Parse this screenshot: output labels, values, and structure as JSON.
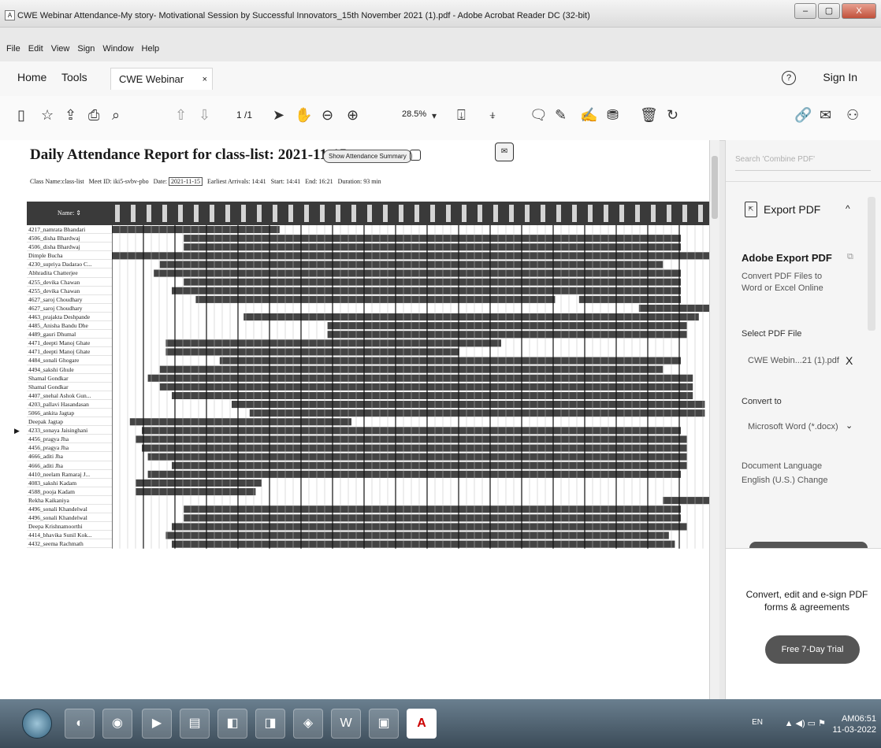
{
  "window": {
    "title": "CWE Webinar Attendance-My story- Motivational Session by Successful Innovators_15th November 2021 (1).pdf - Adobe Acrobat Reader DC (32-bit)",
    "controls": [
      "–",
      "▢",
      "X"
    ]
  },
  "menu": [
    "File",
    "Edit",
    "View",
    "Sign",
    "Window",
    "Help"
  ],
  "tabs": {
    "home": "Home",
    "tools": "Tools",
    "document": "CWE Webinar Atte...",
    "close": "×",
    "help": "?",
    "signin": "Sign In"
  },
  "toolbar": {
    "page_current": "1",
    "page_total": "/1",
    "zoom": "28.5%"
  },
  "document": {
    "title": "Daily Attendance Report for class-list: 2021-11-15",
    "summary_button": "Show Attendance Summary",
    "meta": {
      "class": "Class Name:class-list",
      "meet": "Meet ID: iki5-svbv-pbo",
      "date_label": "Date:",
      "date": "2021-11-15",
      "earliest": "Earliest Arrivals: 14:41",
      "start": "Start: 14:41",
      "end": "End: 16:21",
      "duration": "Duration: 93 min"
    },
    "name_header": "Name: ⇕",
    "attendees": [
      "4217_namrata Bhandari",
      "4506_disha Bhardwaj",
      "4506_disha Bhardwaj",
      "Dimple Bucha",
      "4230_supriya Dadarao C...",
      "Abhradita Chatterjee",
      "4255_devika Chawan",
      "4255_devika Chawan",
      "4627_saroj Choudhary",
      "4627_saroj Choudhary",
      "4463_prajakta Deshpande",
      "4485_Anisha Bandu Dhe",
      "4489_gauri Dhumal",
      "4471_deepti Manoj Ghate",
      "4471_deepti Manoj Ghate",
      "4484_sonali Ghogare",
      "4494_sakshi Ghule",
      "Shamal Gondkar",
      "Shamal Gondkar",
      "4407_snehal Ashok Gun...",
      "4203_pallavi Hasandasan",
      "5066_ankita Jagtap",
      "Deepak Jagtap",
      "4233_sonaya Jaisinghani",
      "4456_pragya Jha",
      "4456_pragya Jha",
      "4666_aditi Jha",
      "4666_aditi Jha",
      "4410_neelam Ramaraj J...",
      "4083_sakshi Kadam",
      "4588_pooja Kadam",
      "Rekha Kaikaniya",
      "4496_sonali Khandelwal",
      "4496_sonali Khandelwal",
      "Deepa Krishnamoorthi",
      "4414_bhavika Sunil Kok...",
      "4432_seema Rachmath"
    ]
  },
  "right_panel": {
    "search_placeholder": "Search 'Combine PDF'",
    "export_title": "Export PDF",
    "export_caret": "^",
    "heading": "Adobe Export PDF",
    "description": "Convert PDF Files to Word or Excel Online",
    "select_label": "Select PDF File",
    "selected_file": "CWE Webin...21 (1).pdf",
    "remove": "X",
    "convert_label": "Convert to",
    "convert_value": "Microsoft Word (*.docx)",
    "convert_chevron": "⌄",
    "language_label": "Document Language",
    "language_value": "English (U.S.) Change",
    "promo_text": "Convert, edit and e-sign PDF forms & agreements",
    "trial_button": "Free 7-Day Trial"
  },
  "taskbar": {
    "lang": "EN",
    "time": "AM06:51",
    "date": "11-03-2022"
  },
  "colors": {
    "presence": "#444444",
    "header": "#3a3a3a",
    "trial_button": "#555555"
  }
}
